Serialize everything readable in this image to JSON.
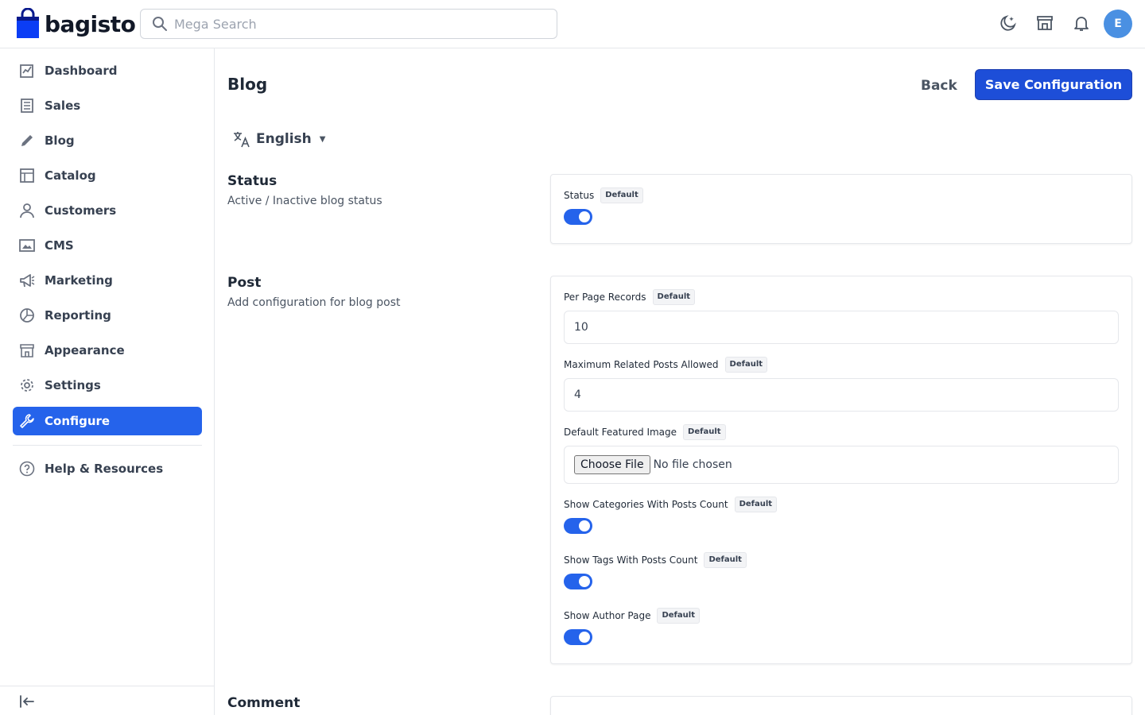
{
  "header": {
    "brand": "bagisto",
    "search_placeholder": "Mega Search",
    "avatar_initial": "E",
    "icons": [
      "moon-sparkle-icon",
      "storefront-icon",
      "bell-icon"
    ]
  },
  "sidebar": {
    "items": [
      {
        "label": "Dashboard",
        "icon": "dashboard-icon"
      },
      {
        "label": "Sales",
        "icon": "receipt-icon"
      },
      {
        "label": "Blog",
        "icon": "pencil-icon"
      },
      {
        "label": "Catalog",
        "icon": "catalog-icon"
      },
      {
        "label": "Customers",
        "icon": "user-icon"
      },
      {
        "label": "CMS",
        "icon": "image-icon"
      },
      {
        "label": "Marketing",
        "icon": "megaphone-icon"
      },
      {
        "label": "Reporting",
        "icon": "pie-chart-icon"
      },
      {
        "label": "Appearance",
        "icon": "storefront-icon"
      },
      {
        "label": "Settings",
        "icon": "gear-icon"
      },
      {
        "label": "Configure",
        "icon": "wrench-icon",
        "active": true
      }
    ],
    "help": {
      "label": "Help & Resources",
      "icon": "help-circle-icon"
    }
  },
  "page": {
    "title": "Blog",
    "back_label": "Back",
    "save_label": "Save Configuration",
    "language": "English"
  },
  "sections": {
    "status": {
      "title": "Status",
      "description": "Active / Inactive blog status",
      "fields": {
        "status": {
          "label": "Status",
          "badge": "Default",
          "enabled": true
        }
      }
    },
    "post": {
      "title": "Post",
      "description": "Add configuration for blog post",
      "fields": {
        "per_page": {
          "label": "Per Page Records",
          "badge": "Default",
          "value": "10"
        },
        "max_related": {
          "label": "Maximum Related Posts Allowed",
          "badge": "Default",
          "value": "4"
        },
        "featured_image": {
          "label": "Default Featured Image",
          "badge": "Default",
          "button": "Choose File",
          "status": "No file chosen"
        },
        "categories_count": {
          "label": "Show Categories With Posts Count",
          "badge": "Default",
          "enabled": true
        },
        "tags_count": {
          "label": "Show Tags With Posts Count",
          "badge": "Default",
          "enabled": true
        },
        "author_page": {
          "label": "Show Author Page",
          "badge": "Default",
          "enabled": true
        }
      }
    },
    "comment": {
      "title": "Comment"
    }
  },
  "colors": {
    "accent": "#2563eb",
    "avatar": "#4a90e2",
    "border": "#e5e7eb"
  }
}
